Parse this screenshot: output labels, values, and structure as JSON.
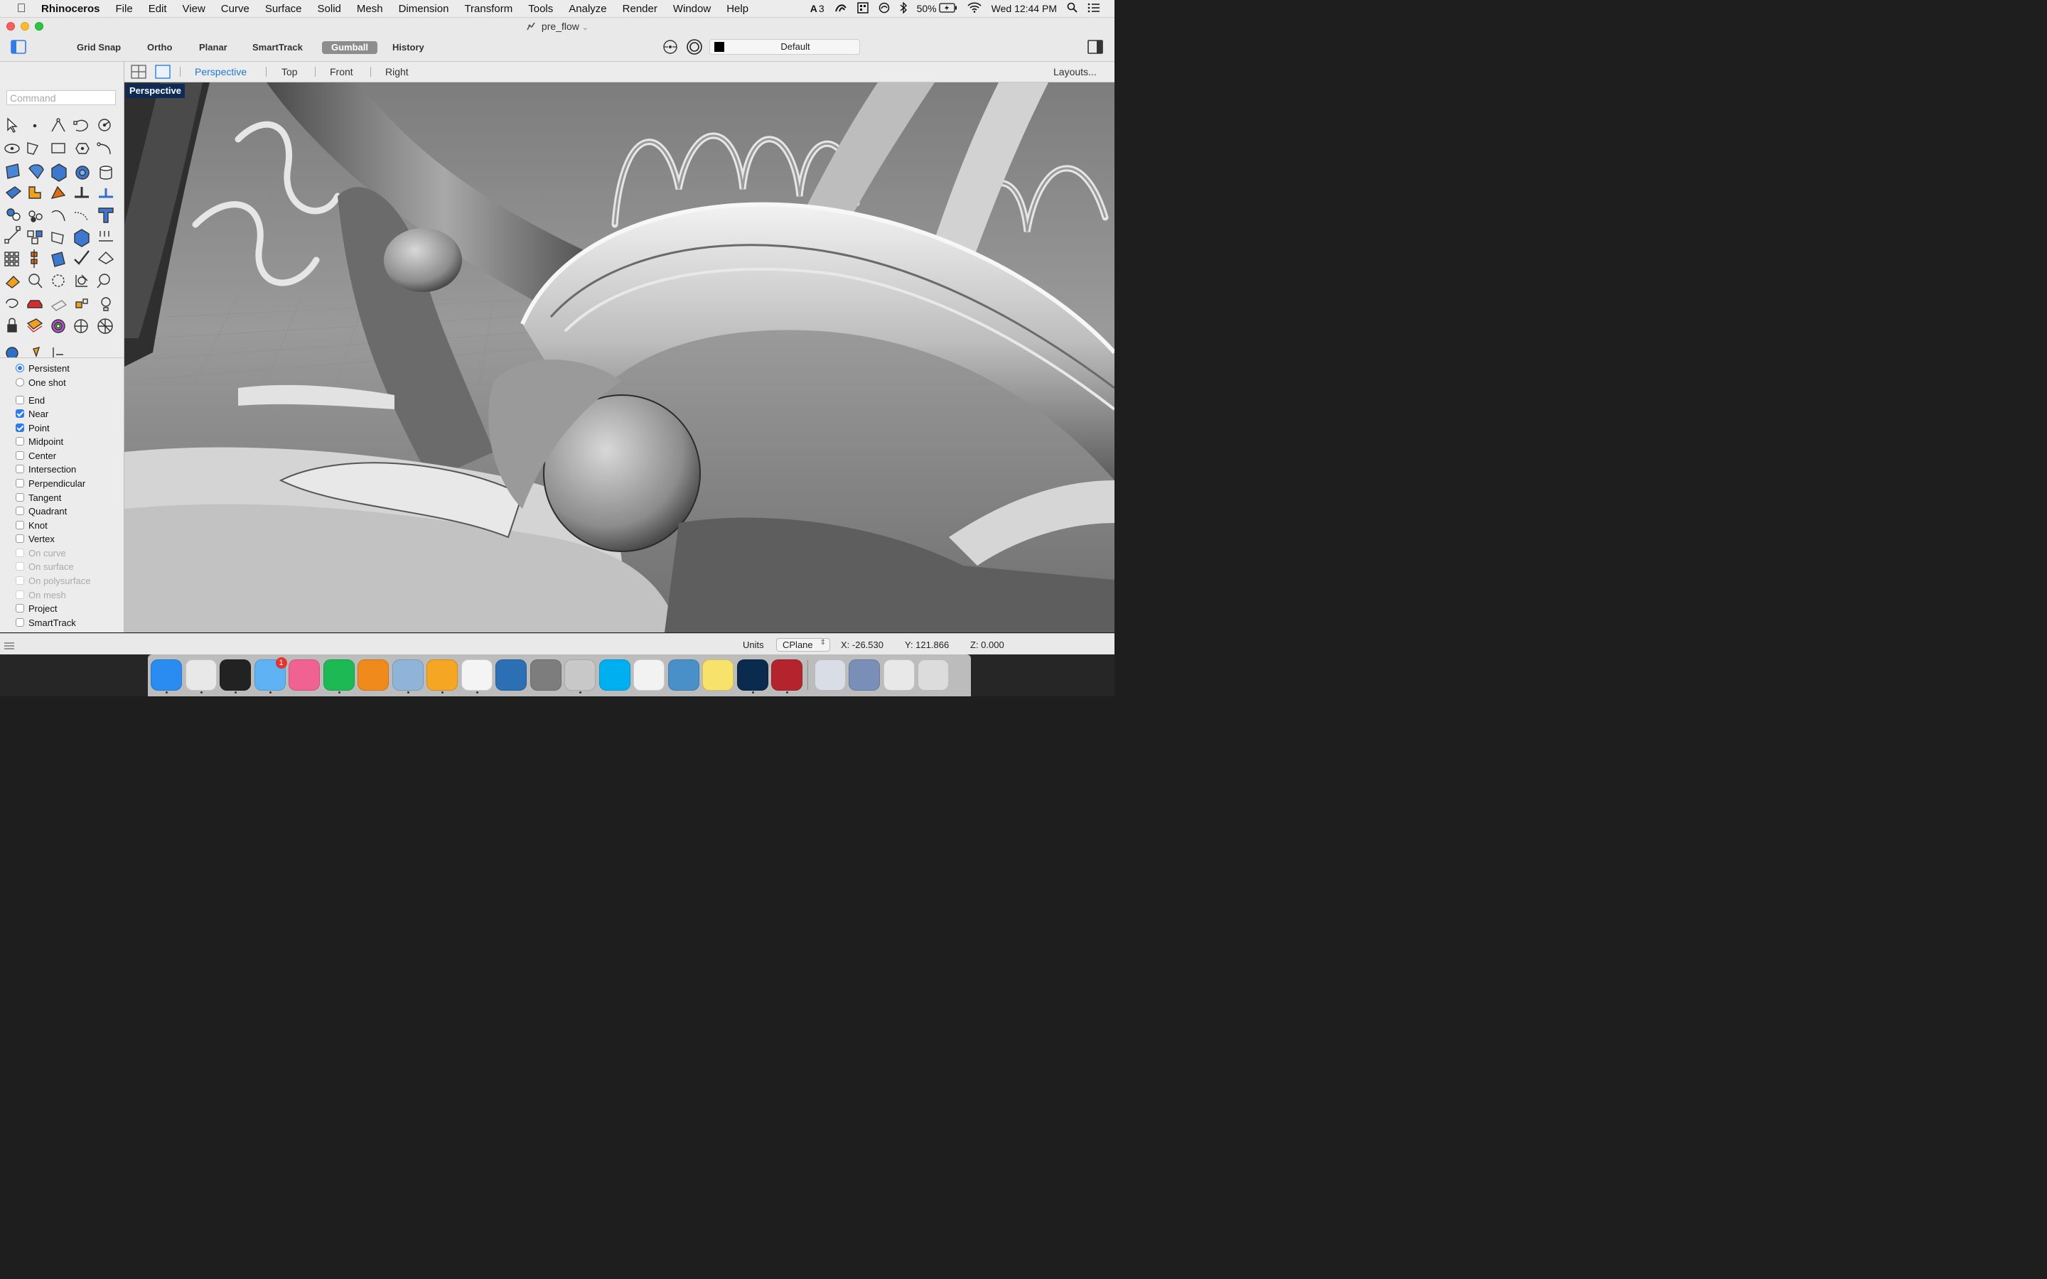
{
  "menubar": {
    "apple_icon": "apple-logo-icon",
    "items": [
      "Rhinoceros",
      "File",
      "Edit",
      "View",
      "Curve",
      "Surface",
      "Solid",
      "Mesh",
      "Dimension",
      "Transform",
      "Tools",
      "Analyze",
      "Render",
      "Window",
      "Help"
    ],
    "status": {
      "adobe_count": "3",
      "battery": "50%",
      "clock": "Wed 12:44 PM"
    }
  },
  "window": {
    "title": "pre_flow",
    "title_chevron": "⌄"
  },
  "toolbar": {
    "buttons": [
      {
        "label": "Grid Snap",
        "active": false
      },
      {
        "label": "Ortho",
        "active": false
      },
      {
        "label": "Planar",
        "active": false
      },
      {
        "label": "SmartTrack",
        "active": false
      },
      {
        "label": "Gumball",
        "active": true
      },
      {
        "label": "History",
        "active": false
      }
    ],
    "layer": {
      "name": "Default",
      "color": "#000000"
    }
  },
  "command": {
    "placeholder": "Command"
  },
  "view_tabs": {
    "tabs": [
      {
        "label": "Perspective",
        "active": true
      },
      {
        "label": "Top",
        "active": false
      },
      {
        "label": "Front",
        "active": false
      },
      {
        "label": "Right",
        "active": false
      }
    ],
    "layouts": "Layouts..."
  },
  "viewport": {
    "label": "Perspective"
  },
  "osnap": {
    "modes": [
      {
        "label": "Persistent",
        "selected": true
      },
      {
        "label": "One shot",
        "selected": false
      }
    ],
    "items": [
      {
        "label": "End",
        "checked": false,
        "enabled": true
      },
      {
        "label": "Near",
        "checked": true,
        "enabled": true
      },
      {
        "label": "Point",
        "checked": true,
        "enabled": true
      },
      {
        "label": "Midpoint",
        "checked": false,
        "enabled": true
      },
      {
        "label": "Center",
        "checked": false,
        "enabled": true
      },
      {
        "label": "Intersection",
        "checked": false,
        "enabled": true
      },
      {
        "label": "Perpendicular",
        "checked": false,
        "enabled": true
      },
      {
        "label": "Tangent",
        "checked": false,
        "enabled": true
      },
      {
        "label": "Quadrant",
        "checked": false,
        "enabled": true
      },
      {
        "label": "Knot",
        "checked": false,
        "enabled": true
      },
      {
        "label": "Vertex",
        "checked": false,
        "enabled": true
      },
      {
        "label": "On curve",
        "checked": false,
        "enabled": false
      },
      {
        "label": "On surface",
        "checked": false,
        "enabled": false
      },
      {
        "label": "On polysurface",
        "checked": false,
        "enabled": false
      },
      {
        "label": "On mesh",
        "checked": false,
        "enabled": false
      },
      {
        "label": "Project",
        "checked": false,
        "enabled": true
      },
      {
        "label": "SmartTrack",
        "checked": false,
        "enabled": true
      }
    ]
  },
  "status_bar": {
    "units_label": "Units",
    "cplane": "CPlane",
    "x": "X: -26.530",
    "y": "Y: 121.866",
    "z": "Z: 0.000"
  },
  "dock": {
    "apps": [
      {
        "name": "finder-icon",
        "color": "#2a8cf0",
        "running": true
      },
      {
        "name": "chrome-icon",
        "color": "#e8e8e8",
        "running": true
      },
      {
        "name": "terminal-icon",
        "color": "#222222",
        "running": true
      },
      {
        "name": "messages-icon",
        "color": "#5fb3f5",
        "running": true,
        "badge": "1"
      },
      {
        "name": "itunes-icon",
        "color": "#f06292",
        "running": false
      },
      {
        "name": "spotify-icon",
        "color": "#1db954",
        "running": true
      },
      {
        "name": "vlc-icon",
        "color": "#f08a1c",
        "running": false
      },
      {
        "name": "preview-icon",
        "color": "#8fb4d8",
        "running": true
      },
      {
        "name": "pages-icon",
        "color": "#f5a623",
        "running": true
      },
      {
        "name": "textedit-icon",
        "color": "#f4f4f4",
        "running": true
      },
      {
        "name": "thunderbird-icon",
        "color": "#2d6fb5",
        "running": false
      },
      {
        "name": "system-preferences-icon",
        "color": "#7d7d7d",
        "running": false
      },
      {
        "name": "rhinoceros-icon",
        "color": "#c8c8c8",
        "running": true
      },
      {
        "name": "skype-icon",
        "color": "#00aff0",
        "running": false
      },
      {
        "name": "one-piece-icon",
        "color": "#f2f2f2",
        "running": false
      },
      {
        "name": "network-utility-icon",
        "color": "#4a90c8",
        "running": false
      },
      {
        "name": "stickies-icon",
        "color": "#f7e26b",
        "running": false
      },
      {
        "name": "photoshop-icon",
        "color": "#0a2b4e",
        "running": true
      },
      {
        "name": "photo-booth-icon",
        "color": "#b3242c",
        "running": true
      },
      {
        "name": "music-folder-icon",
        "color": "#d8dde6",
        "running": false
      },
      {
        "name": "documents-stack-icon",
        "color": "#7a8fb8",
        "running": false
      },
      {
        "name": "downloads-stack-icon",
        "color": "#e8e8e8",
        "running": false
      },
      {
        "name": "trash-icon",
        "color": "#dcdcdc",
        "running": false
      }
    ]
  }
}
